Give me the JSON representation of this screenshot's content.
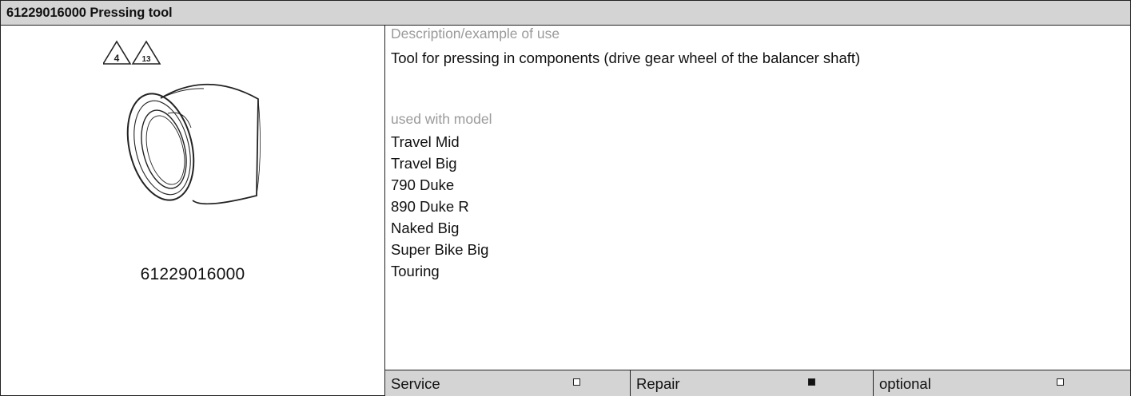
{
  "header": {
    "title": "61229016000 Pressing tool"
  },
  "figure": {
    "warning_signs": [
      "4",
      "13"
    ],
    "part_number": "61229016000"
  },
  "description": {
    "caption": "Description/example of use",
    "text": "Tool for pressing in components (drive gear wheel of the balancer shaft)"
  },
  "models": {
    "caption": "used with model",
    "items": [
      "Travel Mid",
      "Travel Big",
      "790 Duke",
      "890 Duke R",
      "Naked Big",
      "Super Bike Big",
      "Touring"
    ]
  },
  "usage": [
    {
      "label": "Service",
      "checked": false
    },
    {
      "label": "Repair",
      "checked": true
    },
    {
      "label": "optional",
      "checked": false
    }
  ]
}
